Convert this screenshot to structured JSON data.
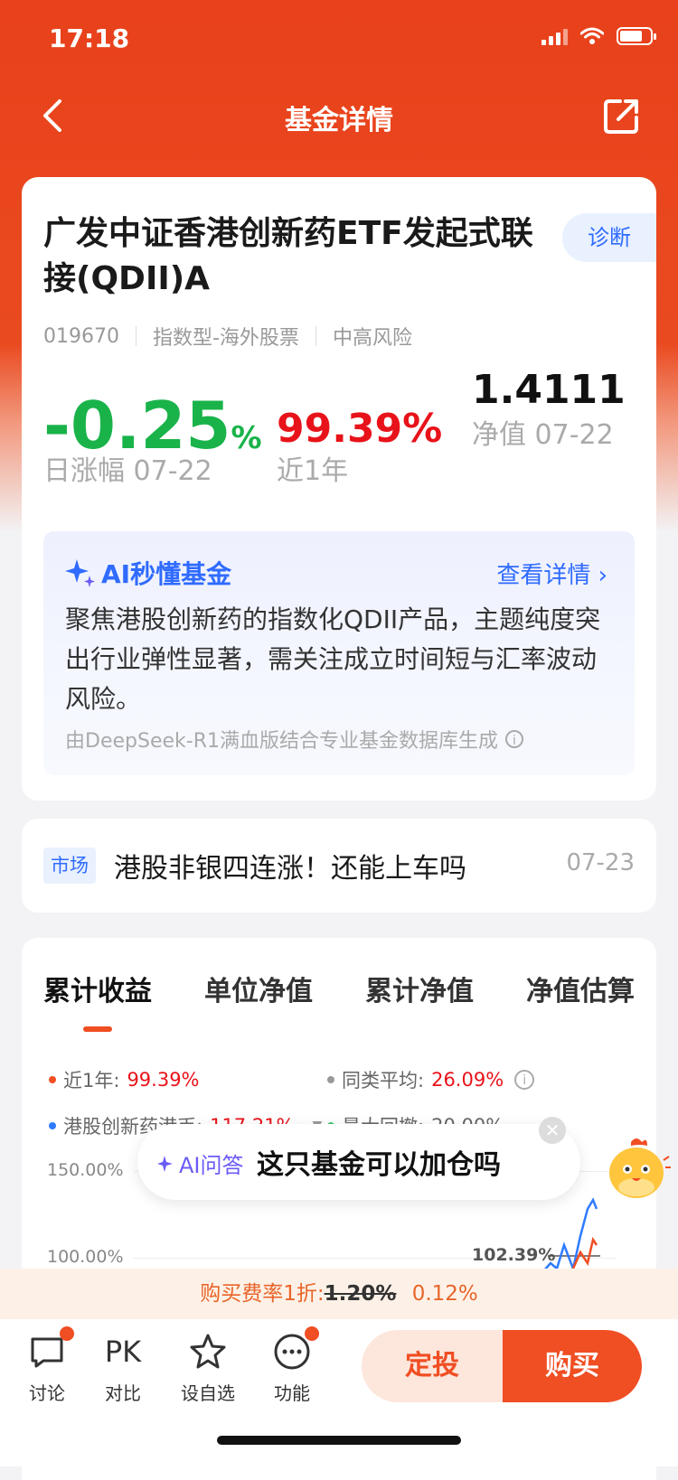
{
  "status_bar": {
    "time": "17:18"
  },
  "nav": {
    "title": "基金详情"
  },
  "fund": {
    "name": "广发中证香港创新药ETF发起式联接(QDII)A",
    "diagnose_label": "诊断",
    "code": "019670",
    "type": "指数型-海外股票",
    "risk": "中高风险",
    "day_change": "-0.25",
    "day_change_unit": "%",
    "day_change_label": "日涨幅 07-22",
    "year_return": "99.39%",
    "year_return_label": "近1年",
    "nav": "1.4111",
    "nav_label": "净值 07-22"
  },
  "ai_summary": {
    "title": "AI秒懂基金",
    "more": "查看详情 ›",
    "text": "聚焦港股创新药的指数化QDII产品，主题纯度突出行业弹性显著，需关注成立时间短与汇率波动风险。",
    "footer": "由DeepSeek-R1满血版结合专业基金数据库生成"
  },
  "news": {
    "tag": "市场",
    "title": "港股非银四连涨！还能上车吗",
    "date": "07-23"
  },
  "chart": {
    "tabs": [
      "累计收益",
      "单位净值",
      "累计净值",
      "净值估算"
    ],
    "legend": [
      {
        "label": "近1年:",
        "value": "99.39%",
        "color": "#f04e23"
      },
      {
        "label": "同类平均:",
        "value": "26.09%",
        "color": "#999999"
      },
      {
        "label": "港股创新药港币:",
        "value": "117.21%",
        "color": "#2f7bff"
      },
      {
        "label": "最大回撤:",
        "value": "20.00%",
        "color": "#3cc26a"
      }
    ],
    "y_ticks": [
      "150.00%",
      "100.00%"
    ],
    "marker_label": "102.39%"
  },
  "ai_popup": {
    "tag": "AI问答",
    "question": "这只基金可以加仓吗"
  },
  "fee": {
    "prefix": "购买费率1折:",
    "original": "1.20%",
    "current": "0.12%"
  },
  "toolbar": {
    "discuss": "讨论",
    "compare_icon": "PK",
    "compare": "对比",
    "watch": "设自选",
    "more": "功能",
    "invest": "定投",
    "buy": "购买"
  }
}
